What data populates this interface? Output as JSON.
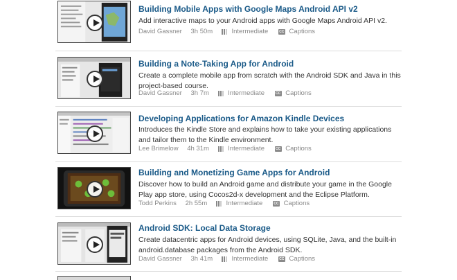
{
  "courses": [
    {
      "title": "Building Mobile Apps with Google Maps Android API v2",
      "description": "Add interactive maps to your Android apps with Google Maps Android API v2.",
      "author": "David Gassner",
      "duration": "3h 50m",
      "level": "Intermediate",
      "captions": "Captions"
    },
    {
      "title": "Building a Note-Taking App for Android",
      "description": "Create a complete mobile app from scratch with the Android SDK and Java in this project-based course.",
      "author": "David Gassner",
      "duration": "3h 7m",
      "level": "Intermediate",
      "captions": "Captions"
    },
    {
      "title": "Developing Applications for Amazon Kindle Devices",
      "description": "Introduces the Kindle Store and explains how to take your existing applications and tailor them to the Kindle environment.",
      "author": "Lee Brimelow",
      "duration": "4h 31m",
      "level": "Intermediate",
      "captions": "Captions"
    },
    {
      "title": "Building and Monetizing Game Apps for Android",
      "description": "Discover how to build an Android game and distribute your game in the Google Play app store, using Cocos2d-x development and the Eclipse Platform.",
      "author": "Todd Perkins",
      "duration": "2h 55m",
      "level": "Intermediate",
      "captions": "Captions"
    },
    {
      "title": "Android SDK: Local Data Storage",
      "description": "Create datacentric apps for Android devices, using SQLite, Java, and the built-in android.database packages from the Android SDK.",
      "author": "David Gassner",
      "duration": "3h 41m",
      "level": "Intermediate",
      "captions": "Captions"
    }
  ],
  "icons": {
    "play": "play-icon",
    "level": "level-bars-icon",
    "captions": "captions-icon"
  }
}
